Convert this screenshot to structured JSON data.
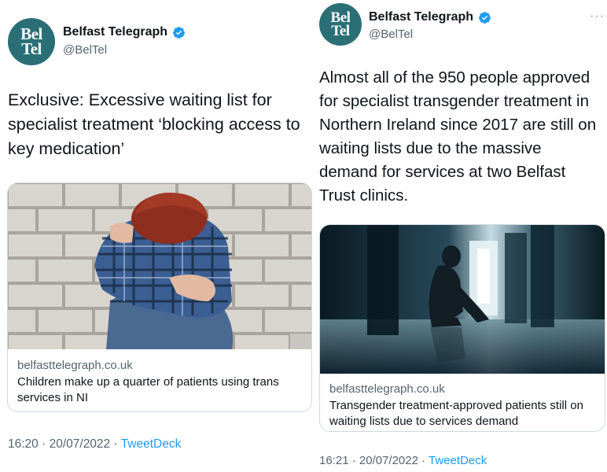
{
  "tweets": [
    {
      "author": {
        "name": "Belfast Telegraph",
        "handle": "@BelTel",
        "avatar_line1": "Bel",
        "avatar_line2": "Tel"
      },
      "text": "Exclusive: Excessive waiting list for specialist treatment ‘blocking access to key medication’",
      "card": {
        "domain": "belfasttelegraph.co.uk",
        "title": "Children make up a quarter of patients using trans services in NI"
      },
      "time": "16:20",
      "date": "20/07/2022",
      "source": "TweetDeck",
      "separator": "·"
    },
    {
      "author": {
        "name": "Belfast Telegraph",
        "handle": "@BelTel",
        "avatar_line1": "Bel",
        "avatar_line2": "Tel"
      },
      "more_label": "···",
      "text": "Almost all of the 950 people approved for specialist transgender treatment in Northern Ireland since 2017 are still on waiting lists due to the massive demand for services at two Belfast Trust clinics.",
      "card": {
        "domain": "belfasttelegraph.co.uk",
        "title": "Transgender treatment-approved patients still on waiting lists due to services demand"
      },
      "time": "16:21",
      "date": "20/07/2022",
      "source": "TweetDeck",
      "separator": "·"
    }
  ],
  "colors": {
    "accent": "#1d9bf0",
    "avatar_bg": "#2a6f76",
    "secondary_text": "#536471"
  },
  "icons": [
    "verified-badge-icon",
    "more-options-icon"
  ]
}
